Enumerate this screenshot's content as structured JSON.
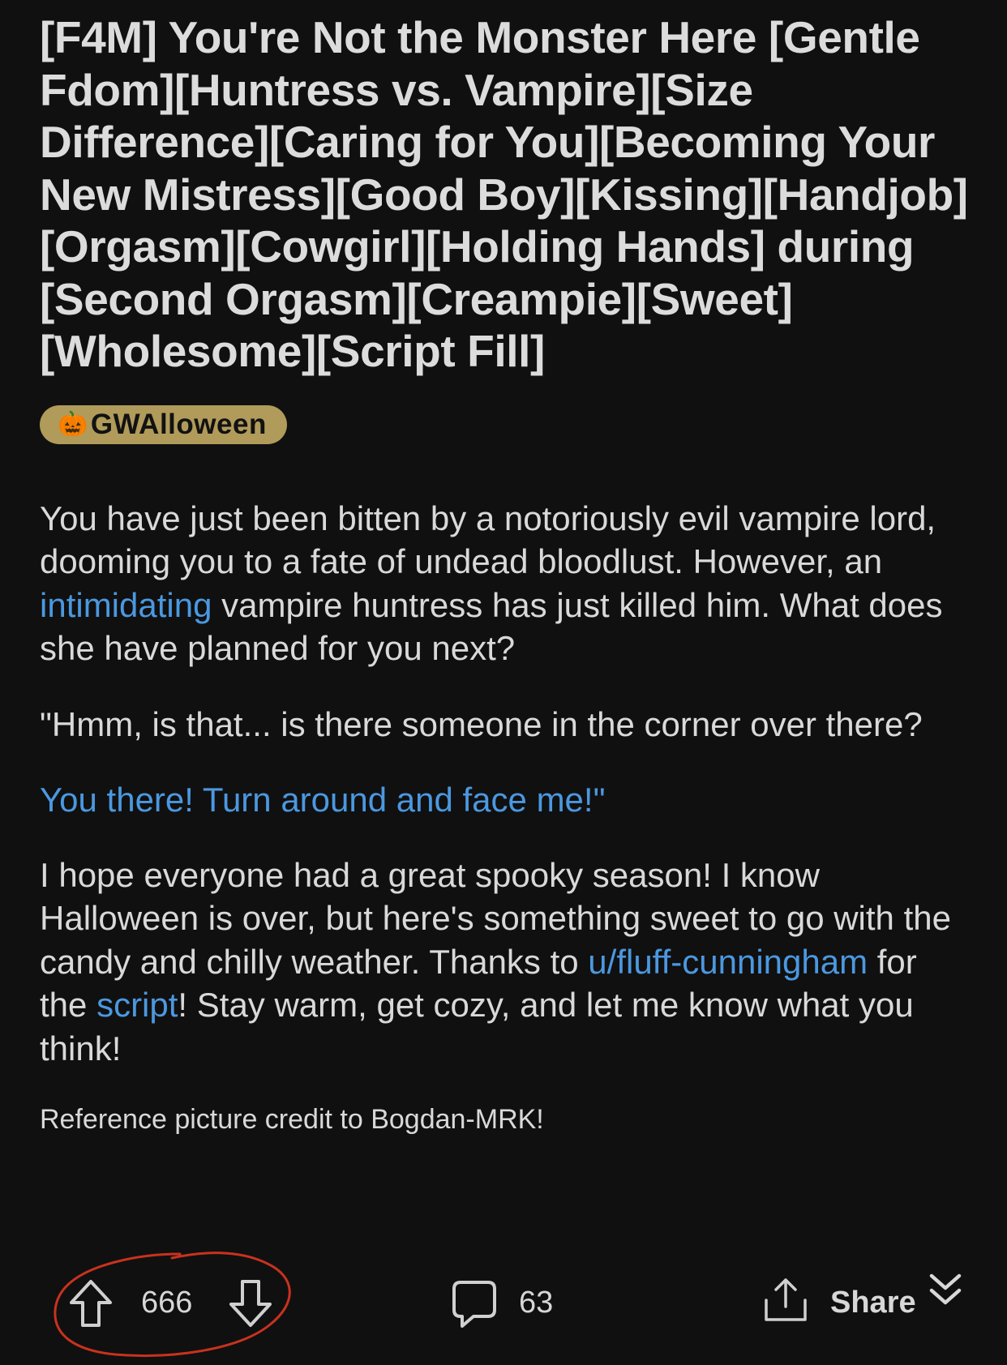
{
  "post": {
    "title": "[F4M] You're Not the Monster Here [Gentle Fdom][Huntress vs. Vampire][Size Difference][Caring for You][Becoming Your New Mistress][Good Boy][Kissing][Handjob][Orgasm][Cowgirl][Holding Hands] during [Second Orgasm][Creampie][Sweet][Wholesome][Script Fill]",
    "flair": {
      "icon": "jack-o-lantern-icon",
      "glyph": "🎃",
      "label": "GWAlloween",
      "color": "#b09b5a"
    },
    "body": {
      "p1_before": "You have just been bitten by a notoriously evil vampire lord, dooming you to a fate of undead bloodlust. However, an ",
      "p1_link": "intimidating",
      "p1_after": " vampire huntress has just killed him. What does she have planned for you next?",
      "p2": "\"Hmm, is that... is there someone in the corner over there?",
      "p3_link": "You there! Turn around and face me!\"",
      "p4_before": "I hope everyone had a great spooky season! I know Halloween is over, but here's something sweet to go with the candy and chilly weather. Thanks to ",
      "p4_user_link": "u/fluff-cunningham",
      "p4_mid": " for the ",
      "p4_script_link": "script",
      "p4_after": "! Stay warm, get cozy, and let me know what you think!",
      "credit": "Reference picture credit to Bogdan-MRK!"
    }
  },
  "actions": {
    "upvote_icon": "arrow-up-icon",
    "vote_count": "666",
    "downvote_icon": "arrow-down-icon",
    "comment_icon": "comment-bubble-icon",
    "comment_count": "63",
    "share_icon": "share-icon",
    "share_label": "Share",
    "collapse_icon": "double-chevron-down-icon"
  },
  "colors": {
    "background": "#101010",
    "text": "#d9d9d9",
    "link": "#4b98e0",
    "annotation": "#c8321e"
  }
}
